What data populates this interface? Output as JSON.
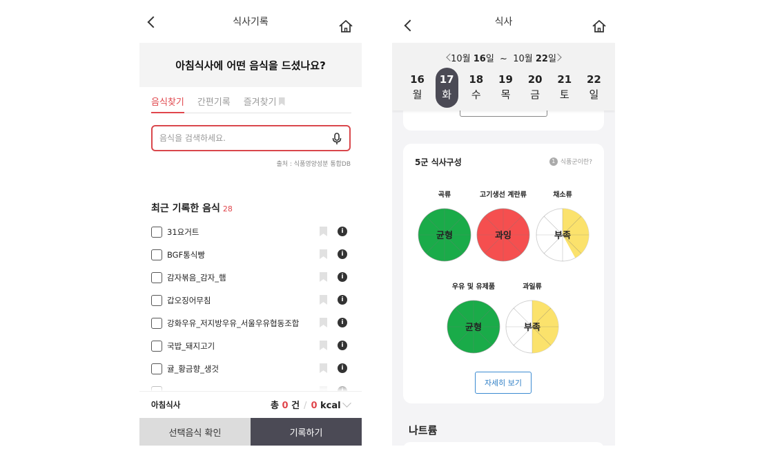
{
  "left": {
    "header": {
      "title": "식사기록"
    },
    "question": "아침식사에 어떤 음식을 드셨나요?",
    "tabs": [
      {
        "label": "음식찾기",
        "active": true
      },
      {
        "label": "간편기록",
        "active": false
      },
      {
        "label": "즐겨찾기",
        "active": false
      }
    ],
    "search": {
      "placeholder": "음식을 검색하세요.",
      "value": ""
    },
    "source": "출처 : 식품영양성분 통합DB",
    "recent": {
      "title": "최근 기록한 음식",
      "count": "28",
      "items": [
        "31요거트",
        "BGF통식빵",
        "감자볶음_감자_햄",
        "갑오징어무침",
        "강화우유_저지방우유_서울우유협동조합",
        "국밥_돼지고기",
        "귤_황금향_생것"
      ]
    },
    "summary": {
      "meal": "아침식사",
      "total_prefix": "총",
      "count": "0",
      "count_unit": "건",
      "sep": "/",
      "kcal": "0",
      "kcal_unit": "kcal"
    },
    "buttons": {
      "confirm": "선택음식 확인",
      "record": "기록하기"
    }
  },
  "right": {
    "header": {
      "title": "식사"
    },
    "range": {
      "start_month": "10월",
      "start_day": "16",
      "start_suffix": "일",
      "tilde": "~",
      "end_month": "10월",
      "end_day": "22",
      "end_suffix": "일"
    },
    "days": [
      {
        "num": "16",
        "wd": "월",
        "active": false
      },
      {
        "num": "17",
        "wd": "화",
        "active": true
      },
      {
        "num": "18",
        "wd": "수",
        "active": false
      },
      {
        "num": "19",
        "wd": "목",
        "active": false
      },
      {
        "num": "20",
        "wd": "금",
        "active": false
      },
      {
        "num": "21",
        "wd": "토",
        "active": false
      },
      {
        "num": "22",
        "wd": "일",
        "active": false
      }
    ],
    "food_groups": {
      "title": "5군 식사구성",
      "help_icon": "1",
      "help": "식품군이란?",
      "groups": [
        {
          "label": "곡류",
          "status": "균형",
          "color": "#1aab49",
          "fill_fraction": 1.0
        },
        {
          "label": "고기생선 계란류",
          "status": "과잉",
          "color": "#f54f4f",
          "fill_fraction": 1.0
        },
        {
          "label": "채소류",
          "status": "부족",
          "color": "#fbe26c",
          "fill_fraction": 0.42
        },
        {
          "label": "우유 및 유제품",
          "status": "균형",
          "color": "#1aab49",
          "fill_fraction": 1.0
        },
        {
          "label": "과일류",
          "status": "부족",
          "color": "#fbe26c",
          "fill_fraction": 0.5
        }
      ],
      "detail_button": "자세히 보기"
    },
    "next_section": "나트륨"
  }
}
